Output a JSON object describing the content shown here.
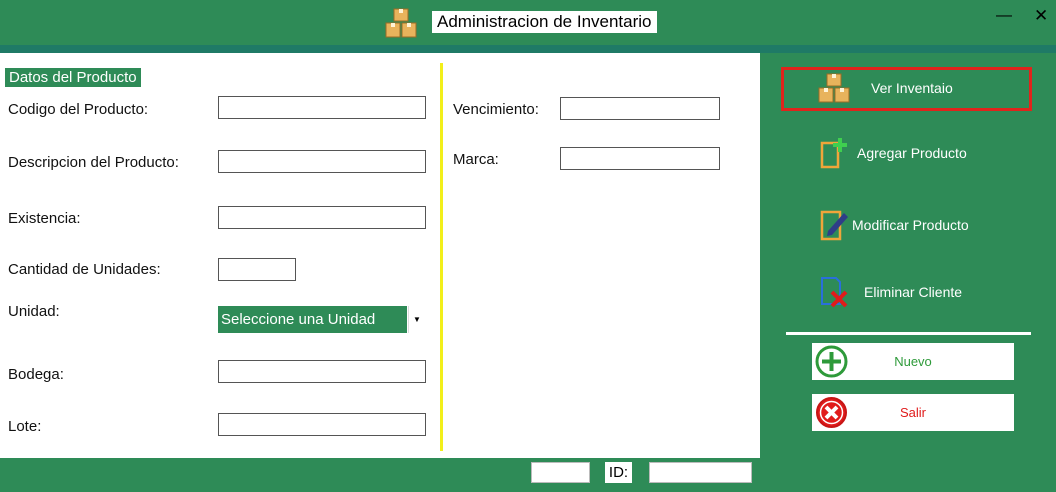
{
  "window": {
    "title": "Administracion de Inventario",
    "minimize": "—",
    "close": "✕"
  },
  "form": {
    "section_label": "Datos del Producto",
    "codigo_label": "Codigo del Producto:",
    "codigo_value": "",
    "descripcion_label": "Descripcion del Producto:",
    "descripcion_value": "",
    "existencia_label": "Existencia:",
    "existencia_value": "",
    "cantidad_label": "Cantidad de Unidades:",
    "cantidad_value": "",
    "unidad_label": "Unidad:",
    "unidad_selected": "Seleccione una Unidad",
    "unidad_arrow": "▼",
    "bodega_label": "Bodega:",
    "bodega_value": "",
    "lote_label": "Lote:",
    "lote_value": "",
    "vencimiento_label": "Vencimiento:",
    "vencimiento_value": "",
    "marca_label": "Marca:",
    "marca_value": ""
  },
  "sidebar": {
    "ver_inventario": "Ver Inventaio",
    "agregar": "Agregar Producto",
    "modificar": "Modificar Producto",
    "eliminar": "Eliminar Cliente",
    "nuevo": "Nuevo",
    "salir": "Salir"
  },
  "status": {
    "id_label": "ID:",
    "left_value": "",
    "id_value": ""
  },
  "colors": {
    "brand_green": "#2e8b57",
    "divider_yellow": "#f2ef1a",
    "highlight_red": "#e0241c",
    "nuevo_green": "#2e9a3a",
    "salir_red": "#e01b1b"
  }
}
